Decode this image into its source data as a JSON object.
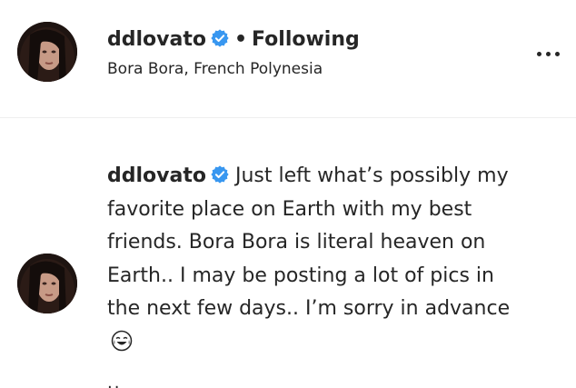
{
  "post_header": {
    "username": "ddlovato",
    "separator": "•",
    "follow_status": "Following",
    "location": "Bora Bora, French Polynesia"
  },
  "caption": {
    "username": "ddlovato",
    "text": "Just left what’s possibly my favorite place on Earth with my best friends. Bora Bora is literal heaven on Earth.. I may be posting a lot of pics in the next few days.. I’m sorry in advance"
  },
  "icons": {
    "verified": "verified-badge-icon",
    "more": "more-options-icon",
    "emoji": "tears-of-joy-emoji"
  },
  "colors": {
    "verified_blue": "#3897f0",
    "text": "#262626",
    "divider": "#efefef"
  }
}
